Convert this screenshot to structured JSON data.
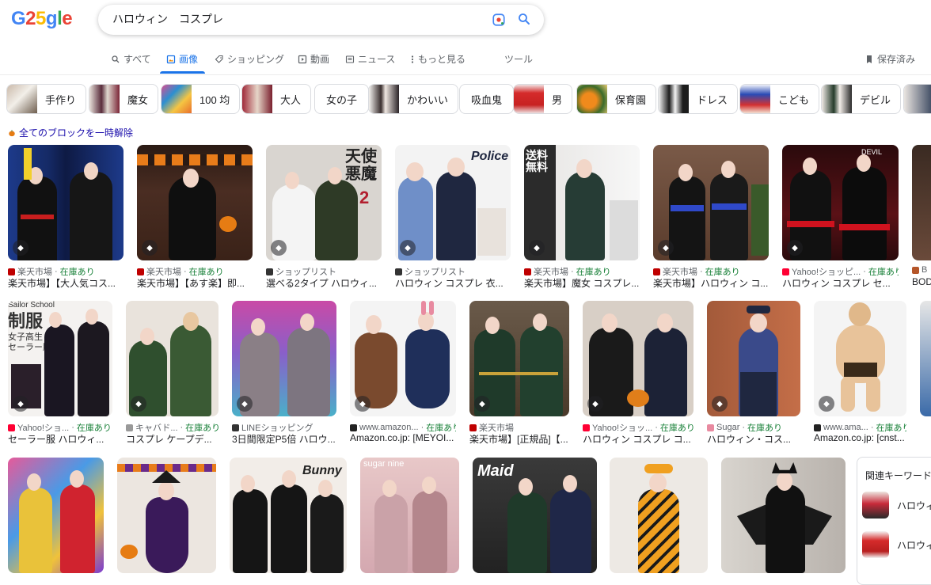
{
  "logo": {
    "text": "G25gle"
  },
  "search": {
    "query": "ハロウィン　コスプレ"
  },
  "tabs": [
    {
      "label": "すべて",
      "icon": "search-icon"
    },
    {
      "label": "画像",
      "icon": "image-icon"
    },
    {
      "label": "ショッピング",
      "icon": "tag-icon"
    },
    {
      "label": "動画",
      "icon": "play-icon"
    },
    {
      "label": "ニュース",
      "icon": "news-icon"
    },
    {
      "label": "もっと見る",
      "icon": "more-icon"
    },
    {
      "label": "ツール",
      "icon": ""
    }
  ],
  "saved": "保存済み",
  "chips": [
    "手作り",
    "魔女",
    "100 均",
    "大人",
    "女の子",
    "かわいい",
    "吸血鬼",
    "男",
    "保育園",
    "ドレス",
    "こども",
    "デビル"
  ],
  "unblock": "全てのブロックを一時解除",
  "rows": [
    [
      {
        "source": "楽天市場",
        "stock": "在庫あり",
        "title": "楽天市場】【大人気コス..."
      },
      {
        "source": "楽天市場",
        "stock": "在庫あり",
        "title": "楽天市場】【あす楽】即..."
      },
      {
        "source": "ショップリスト",
        "stock": "",
        "title": "選べる2タイプ ハロウィ..."
      },
      {
        "source": "ショップリスト",
        "stock": "",
        "title": "ハロウィン コスプレ 衣..."
      },
      {
        "source": "楽天市場",
        "stock": "在庫あり",
        "title": "楽天市場】魔女 コスプレ..."
      },
      {
        "source": "楽天市場",
        "stock": "在庫あり",
        "title": "楽天市場】ハロウィン コ..."
      },
      {
        "source": "Yahoo!ショッピ...",
        "stock": "在庫あり",
        "title": "ハロウィン コスプレ セ..."
      },
      {
        "source": "B",
        "stock": "",
        "title": "BOD"
      }
    ],
    [
      {
        "source": "Yahoo!ショ...",
        "stock": "在庫あり",
        "title": "セーラー服 ハロウィ..."
      },
      {
        "source": "キャバド...",
        "stock": "在庫あり",
        "title": "コスプレ ケープデ..."
      },
      {
        "source": "LINEショッピング",
        "stock": "",
        "title": "3日間限定P5倍 ハロウ..."
      },
      {
        "source": "www.amazon...",
        "stock": "在庫あり",
        "title": "Amazon.co.jp: [MEYOI..."
      },
      {
        "source": "楽天市場",
        "stock": "",
        "title": "楽天市場】[正規品]【..."
      },
      {
        "source": "Yahoo!ショッ...",
        "stock": "在庫あり",
        "title": "ハロウィン コスプレ コ..."
      },
      {
        "source": "Sugar",
        "stock": "在庫あり",
        "title": "ハロウィン・コス..."
      },
      {
        "source": "www.ama...",
        "stock": "在庫あり",
        "title": "Amazon.co.jp: [cnst..."
      }
    ]
  ],
  "related": {
    "heading": "関連キーワード",
    "items": [
      "ハロウィ",
      "ハロウィ"
    ]
  },
  "colors": {
    "accent": "#1a73e8",
    "stock": "#188038",
    "link": "#1a0dab"
  }
}
